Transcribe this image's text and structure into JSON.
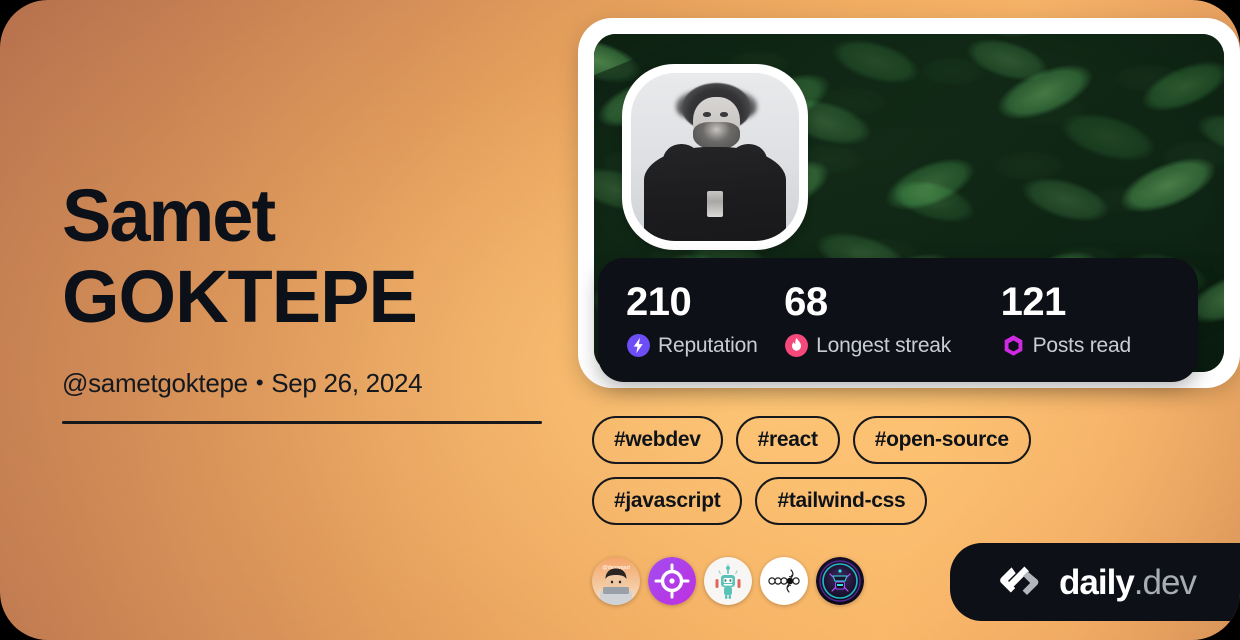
{
  "card": {
    "background_gradient_from": "#a9674a",
    "background_gradient_to": "#f8b86c"
  },
  "profile": {
    "first_name": "Samet",
    "last_name": "GOKTEPE",
    "handle": "@sametgoktepe",
    "separator": "•",
    "joined": "Sep 26, 2024",
    "avatar_alt": "samet-goktepe-portrait",
    "cover_alt": "green-leaves-cover-photo"
  },
  "stats": [
    {
      "value": "210",
      "label": "Reputation",
      "icon": "lightning-bolt-icon",
      "color": "#6d4df6"
    },
    {
      "value": "68",
      "label": "Longest streak",
      "icon": "flame-icon",
      "color": "#f5497c"
    },
    {
      "value": "121",
      "label": "Posts read",
      "icon": "ring-icon",
      "color": "#cf2ae2"
    }
  ],
  "tags": [
    {
      "label": "#webdev"
    },
    {
      "label": "#react"
    },
    {
      "label": "#open-source"
    },
    {
      "label": "#javascript"
    },
    {
      "label": "#tailwind-css"
    }
  ],
  "badges": [
    {
      "name": "memoji-avatar-badge",
      "title": "@deswqad"
    },
    {
      "name": "crosshair-target-badge",
      "title": "crosshair"
    },
    {
      "name": "robot-mascot-badge",
      "title": "robot"
    },
    {
      "name": "node-chain-badge",
      "title": "node-chain"
    },
    {
      "name": "neon-cyber-badge",
      "title": "cyber"
    }
  ],
  "brand": {
    "word_primary": "daily",
    "word_secondary": ".dev",
    "mark": "code-chevron-logo"
  }
}
